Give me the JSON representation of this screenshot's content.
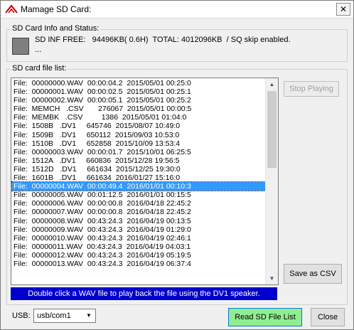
{
  "window": {
    "title": "Mamage SD Card:",
    "close_glyph": "✕"
  },
  "status_group": {
    "legend": "SD Card Info and Status:",
    "line1": "SD INF FREE:   94496KB( 0.6H)  TOTAL: 4012096KB  / SQ skip enabled.",
    "line2": "..."
  },
  "file_list": {
    "legend": "SD card file list:",
    "selected_index": 18,
    "rows": [
      "File:  00000000.WAV  00:00:04.2  2015/05/01 00:25:0",
      "File:  00000001.WAV  00:00:02.5  2015/05/01 00:25:1",
      "File:  00000002.WAV  00:00:05.1  2015/05/01 00:25:2",
      "File:  MEMCH   .CSV       276067  2015/05/01 00:00:5",
      "File:  MEMBK   .CSV         1386  2015/05/01 01:04:0",
      "File:  1508B   .DV1     645746  2015/08/07 10:49:0",
      "File:  1509B   .DV1     650112  2015/09/03 10:53:0",
      "File:  1510B   .DV1     652858  2015/10/09 13:53:4",
      "File:  00000003.WAV  00:00:01.7  2015/10/01 06:25:5",
      "File:  1512A   .DV1     660836  2015/12/28 19:56:5",
      "File:  1512D   .DV1     661634  2015/12/25 19:30:0",
      "File:  1601B   .DV1     661634  2016/01/27 15:16:0",
      "File:  00000004.WAV  00:00:49.4  2016/01/01 00:10:3",
      "File:  00000005.WAV  00:01:12.5  2016/01/01 00:15:5",
      "File:  00000006.WAV  00:00:00.8  2016/04/18 22:45:2",
      "File:  00000007.WAV  00:00:00.8  2016/04/18 22:45:2",
      "File:  00000008.WAV  00:43:24.3  2016/04/19 00:13:5",
      "File:  00000009.WAV  00:43:24.3  2016/04/19 01:29:0",
      "File:  00000010.WAV  00:43:24.3  2016/04/19 02:46:1",
      "File:  00000011.WAV  00:43:24.3  2016/04/19 04:03:1",
      "File:  00000012.WAV  00:43:24.3  2016/04/19 05:19:5",
      "File:  00000013.WAV  00:43:24.3  2016/04/19 06:37:4"
    ]
  },
  "buttons": {
    "stop_playing": "Stop Playing",
    "save_csv": "Save as CSV",
    "read_list": "Read SD File List",
    "close": "Close"
  },
  "hint": "Double click a WAV file to play back the file using the DV1 speaker.",
  "usb": {
    "label": "USB:",
    "value": "usb/com1"
  },
  "colors": {
    "banner": "#0000cc",
    "selection": "#3399ff",
    "read_button": "#90ee90"
  }
}
